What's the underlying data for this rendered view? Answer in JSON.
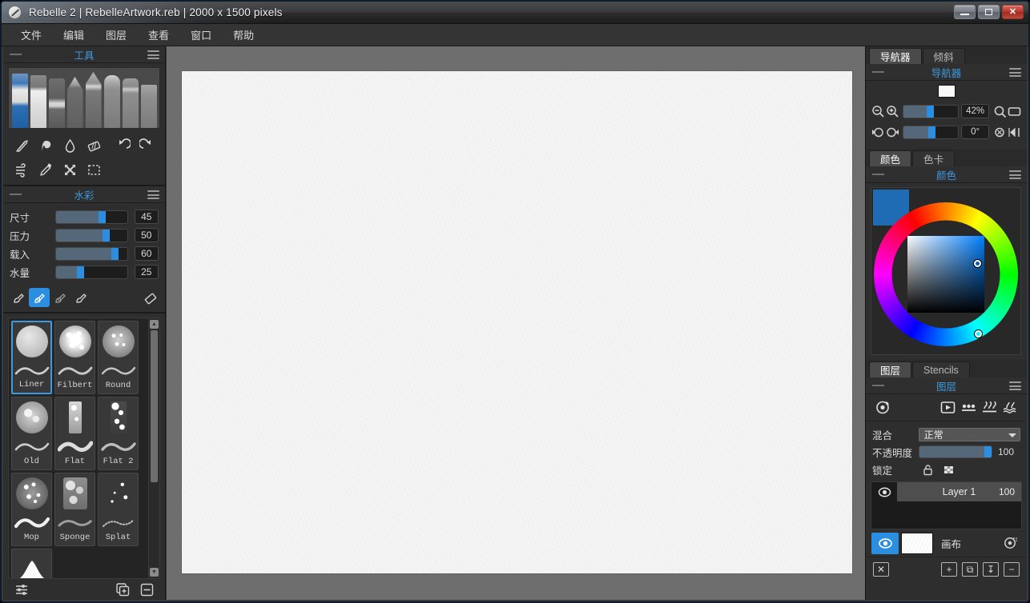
{
  "window": {
    "title": "Rebelle 2 | RebelleArtwork.reb | 2000 x 1500 pixels",
    "minimize_label": "–",
    "maximize_label": "□",
    "close_label": "✕"
  },
  "menubar": {
    "items": [
      {
        "label": "文件"
      },
      {
        "label": "编辑"
      },
      {
        "label": "图层"
      },
      {
        "label": "查看"
      },
      {
        "label": "窗口"
      },
      {
        "label": "帮助"
      }
    ]
  },
  "tools_panel": {
    "title": "工具",
    "brush_tips": [
      {
        "name": "watercolor-brush"
      },
      {
        "name": "dry-brush"
      },
      {
        "name": "marker"
      },
      {
        "name": "pencil"
      },
      {
        "name": "pen"
      },
      {
        "name": "pastel"
      },
      {
        "name": "airbrush"
      },
      {
        "name": "ink-pen"
      }
    ],
    "row1": [
      {
        "name": "palette-knife-icon"
      },
      {
        "name": "smudge-icon"
      },
      {
        "name": "water-drop-icon"
      },
      {
        "name": "eraser-icon"
      },
      {
        "name": "undo-icon"
      },
      {
        "name": "redo-icon"
      }
    ],
    "row2": [
      {
        "name": "blow-icon"
      },
      {
        "name": "eyedropper-icon"
      },
      {
        "name": "move-icon"
      },
      {
        "name": "select-icon"
      }
    ]
  },
  "watercolor_panel": {
    "title": "水彩",
    "sliders": [
      {
        "label": "尺寸",
        "value": "45",
        "pct": 62
      },
      {
        "label": "压力",
        "value": "50",
        "pct": 68
      },
      {
        "label": "载入",
        "value": "60",
        "pct": 80
      },
      {
        "label": "水量",
        "value": "25",
        "pct": 32
      }
    ],
    "brush_types": [
      {
        "name": "brush-type-1",
        "selected": false
      },
      {
        "name": "brush-type-2",
        "selected": true
      },
      {
        "name": "brush-type-3",
        "selected": false
      },
      {
        "name": "brush-type-4",
        "selected": false
      }
    ],
    "eraser": {
      "name": "eraser-tool-icon"
    }
  },
  "brush_presets": {
    "items": [
      {
        "label": "Liner",
        "selected": true,
        "dot": "smooth",
        "stroke": "thin"
      },
      {
        "label": "Filbert",
        "selected": false,
        "dot": "speckle",
        "stroke": "thin"
      },
      {
        "label": "Round",
        "selected": false,
        "dot": "soft-speckle",
        "stroke": "thin"
      },
      {
        "label": "Old",
        "selected": false,
        "dot": "mottled",
        "stroke": "thin"
      },
      {
        "label": "Flat",
        "selected": false,
        "dot": "bar",
        "stroke": "wide"
      },
      {
        "label": "Flat 2",
        "selected": false,
        "dot": "rough-bar",
        "stroke": "wide"
      },
      {
        "label": "Mop",
        "selected": false,
        "dot": "sparse",
        "stroke": "thick"
      },
      {
        "label": "Sponge",
        "selected": false,
        "dot": "sponge",
        "stroke": "rough"
      },
      {
        "label": "Splat",
        "selected": false,
        "dot": "splat",
        "stroke": "splatter"
      }
    ],
    "footer": {
      "settings_icon": "sliders-icon",
      "duplicate_icon": "duplicate-brush-icon",
      "delete_icon": "delete-brush-icon"
    }
  },
  "navigator": {
    "tabs": [
      {
        "label": "导航器",
        "active": true
      },
      {
        "label": "倾斜",
        "active": false
      }
    ],
    "title": "导航器",
    "zoom_value": "42%",
    "zoom_pct": 45,
    "rotation_value": "0°",
    "rotation_pct": 48
  },
  "color": {
    "tabs": [
      {
        "label": "颜色",
        "active": true
      },
      {
        "label": "色卡",
        "active": false
      }
    ],
    "title": "颜色",
    "current_swatch": "#1f6cb5"
  },
  "layers": {
    "tabs": [
      {
        "label": "图层",
        "active": true
      },
      {
        "label": "Stencils",
        "active": false
      }
    ],
    "title": "图层",
    "blend_label": "混合",
    "blend_value": "正常",
    "opacity_label": "不透明度",
    "opacity_value": "100",
    "opacity_pct": 96,
    "lock_label": "锁定",
    "items": [
      {
        "name": "Layer 1",
        "opacity": "100",
        "visible": true
      }
    ],
    "canvas_row": {
      "label": "画布",
      "visible": true
    }
  },
  "canvas": {
    "document_size": "2000 x 1500 pixels"
  },
  "accent": {
    "blue": "#2b8ee0",
    "panel_title": "#3d9ae0",
    "slider_fill": "#55687a"
  }
}
